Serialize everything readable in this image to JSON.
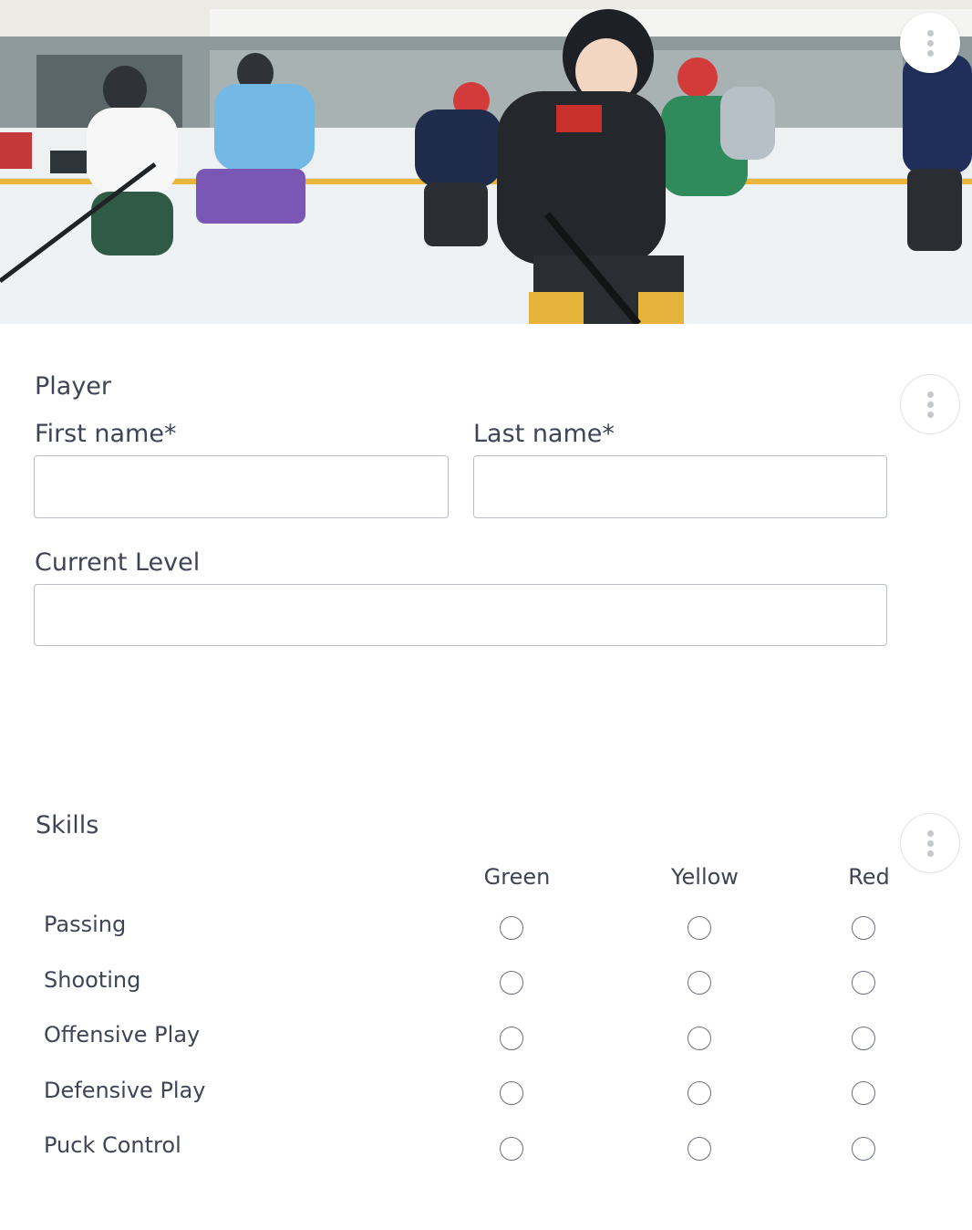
{
  "hero": {
    "icon": "hockey-players-photo"
  },
  "menus": {
    "icon": "more-vertical-icon"
  },
  "player_section": {
    "title": "Player",
    "first_name_label": "First name*",
    "first_name_value": "",
    "last_name_label": "Last name*",
    "last_name_value": "",
    "current_level_label": "Current Level",
    "current_level_value": ""
  },
  "skills_section": {
    "title": "Skills",
    "columns": [
      "Green",
      "Yellow",
      "Red"
    ],
    "rows": [
      "Passing",
      "Shooting",
      "Offensive Play",
      "Defensive Play",
      "Puck Control"
    ]
  }
}
